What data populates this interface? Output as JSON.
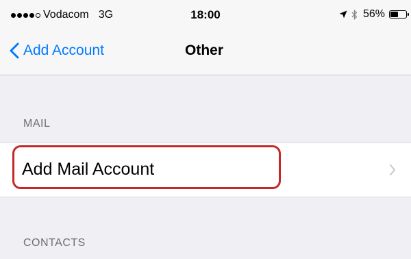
{
  "status_bar": {
    "carrier": "Vodacom",
    "network": "3G",
    "time": "18:00",
    "battery_text": "56%",
    "battery_level": 0.56,
    "signal_strength_dots": 4,
    "signal_total_dots": 5,
    "icons": [
      "location-arrow-icon",
      "bluetooth-icon",
      "battery-icon"
    ]
  },
  "nav": {
    "back_label": "Add Account",
    "title": "Other",
    "accent_color": "#007aff"
  },
  "sections": {
    "mail": {
      "header": "MAIL",
      "rows": [
        {
          "label": "Add Mail Account",
          "icon": "chevron-right-icon"
        }
      ]
    },
    "contacts": {
      "header": "CONTACTS"
    }
  },
  "annotation": {
    "highlight_color": "#c62828"
  }
}
